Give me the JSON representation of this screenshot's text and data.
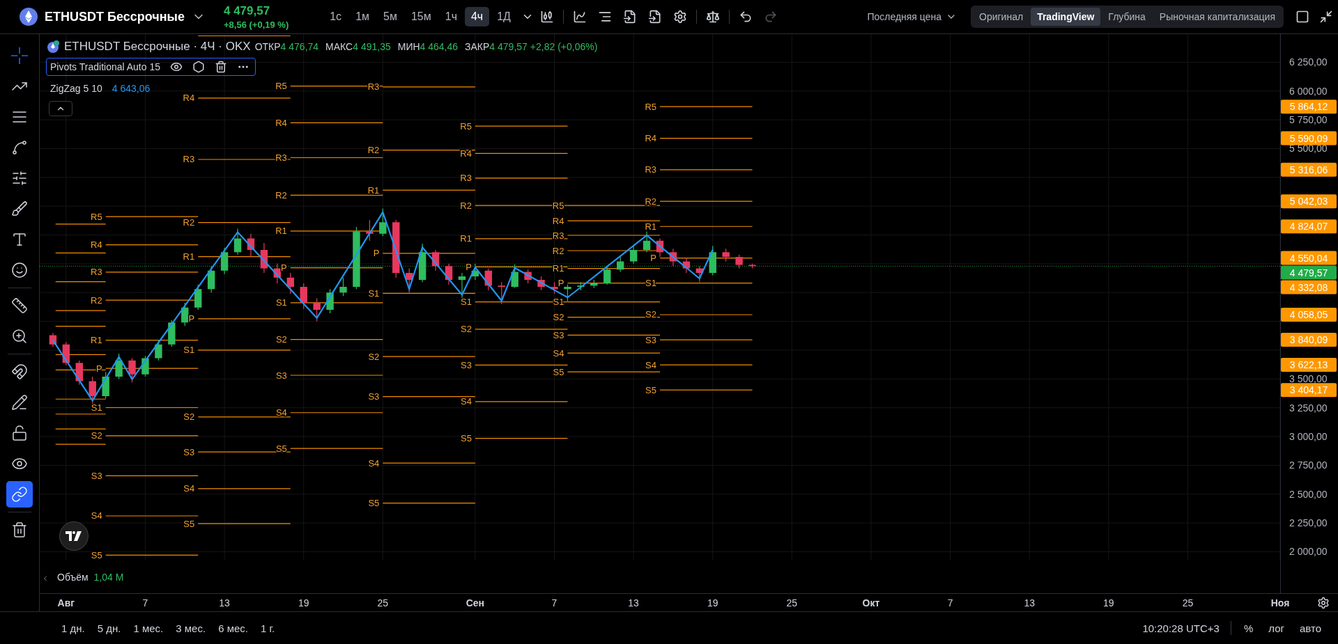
{
  "header": {
    "symbol": "ETHUSDT Бессрочные",
    "price": "4 479,57",
    "change": "+8,56 (+0,19 %)",
    "intervals": [
      {
        "label": "1с",
        "selected": false
      },
      {
        "label": "1м",
        "selected": false
      },
      {
        "label": "5м",
        "selected": false
      },
      {
        "label": "15м",
        "selected": false
      },
      {
        "label": "1ч",
        "selected": false
      },
      {
        "label": "4ч",
        "selected": true
      },
      {
        "label": "1Д",
        "selected": false
      }
    ],
    "price_source": "Последняя цена",
    "views": [
      {
        "label": "Оригинал",
        "selected": false
      },
      {
        "label": "TradingView",
        "selected": true
      },
      {
        "label": "Глубина",
        "selected": false
      },
      {
        "label": "Рыночная капитализация",
        "selected": false
      }
    ]
  },
  "left_toolbar": [
    {
      "kind": "crosshair",
      "selected": true
    },
    {
      "kind": "trend",
      "selected": false
    },
    {
      "kind": "fib",
      "selected": false
    },
    {
      "kind": "pattern",
      "selected": false
    },
    {
      "kind": "forecast",
      "selected": false
    },
    {
      "kind": "brush",
      "selected": false
    },
    {
      "kind": "text",
      "selected": false
    },
    {
      "kind": "emoji",
      "selected": false
    },
    {
      "kind": "measure",
      "selected": false
    },
    {
      "kind": "zoom",
      "selected": false
    },
    {
      "kind": "magnet",
      "selected": false
    },
    {
      "kind": "draw-lock",
      "selected": false
    },
    {
      "kind": "lock",
      "selected": false
    },
    {
      "kind": "eye",
      "selected": false
    },
    {
      "kind": "link",
      "selected": true
    },
    {
      "kind": "trash",
      "selected": false
    }
  ],
  "legend": {
    "title": "ETHUSDT Бессрочные · 4Ч · OKX",
    "ohlc": [
      {
        "label": "ОТКР",
        "value": "4 476,74"
      },
      {
        "label": "МАКС",
        "value": "4 491,35"
      },
      {
        "label": "МИН",
        "value": "4 464,46"
      },
      {
        "label": "ЗАКР",
        "value": "4 479,57"
      }
    ],
    "change": "+2,82 (+0,06%)",
    "indicators": [
      {
        "name": "Pivots Traditional Auto 15",
        "selected": true
      },
      {
        "name": "ZigZag 5 10",
        "value": "4 643,06",
        "selected": false
      }
    ]
  },
  "chart": {
    "chart_data": {
      "type": "candlestick",
      "x": [
        "--07-31",
        "--08-01",
        "--08-02",
        "--08-03",
        "--08-04",
        "--08-05",
        "--08-06",
        "--08-07",
        "--08-08",
        "--08-09",
        "--08-10",
        "--08-11",
        "--08-12",
        "--08-13",
        "--08-14",
        "--08-15",
        "--08-16",
        "--08-17",
        "--08-18",
        "--08-19",
        "--08-20",
        "--08-21",
        "--08-22",
        "--08-23",
        "--08-24",
        "--08-25",
        "--08-26",
        "--08-27",
        "--08-28",
        "--08-29",
        "--08-30",
        "--08-31",
        "--09-01",
        "--09-02",
        "--09-03",
        "--09-04",
        "--09-05",
        "--09-06",
        "--09-07",
        "--09-08",
        "--09-09",
        "--09-10",
        "--09-11",
        "--09-12",
        "--09-13",
        "--09-14",
        "--09-15",
        "--09-16",
        "--09-17",
        "--09-18",
        "--09-19",
        "--09-20",
        "--09-21",
        "--09-22"
      ],
      "ohlc": [
        [
          3880,
          3900,
          3780,
          3800
        ],
        [
          3800,
          3820,
          3620,
          3640
        ],
        [
          3640,
          3660,
          3450,
          3480
        ],
        [
          3480,
          3520,
          3280,
          3350
        ],
        [
          3350,
          3560,
          3330,
          3520
        ],
        [
          3520,
          3720,
          3500,
          3660
        ],
        [
          3660,
          3680,
          3470,
          3540
        ],
        [
          3540,
          3700,
          3520,
          3680
        ],
        [
          3680,
          3840,
          3660,
          3800
        ],
        [
          3800,
          4010,
          3780,
          3990
        ],
        [
          3990,
          4160,
          3960,
          4120
        ],
        [
          4120,
          4320,
          4100,
          4280
        ],
        [
          4280,
          4480,
          4250,
          4440
        ],
        [
          4440,
          4640,
          4410,
          4600
        ],
        [
          4600,
          4805,
          4580,
          4720
        ],
        [
          4720,
          4760,
          4560,
          4620
        ],
        [
          4620,
          4680,
          4420,
          4460
        ],
        [
          4460,
          4500,
          4330,
          4380
        ],
        [
          4380,
          4420,
          4240,
          4300
        ],
        [
          4300,
          4330,
          4110,
          4160
        ],
        [
          4160,
          4200,
          4000,
          4100
        ],
        [
          4100,
          4280,
          4070,
          4250
        ],
        [
          4250,
          4380,
          4220,
          4300
        ],
        [
          4300,
          4820,
          4280,
          4780
        ],
        [
          4780,
          4880,
          4700,
          4760
        ],
        [
          4760,
          4980,
          4740,
          4860
        ],
        [
          4860,
          4880,
          4380,
          4420
        ],
        [
          4420,
          4460,
          4250,
          4360
        ],
        [
          4360,
          4675,
          4340,
          4600
        ],
        [
          4600,
          4620,
          4440,
          4480
        ],
        [
          4480,
          4500,
          4320,
          4360
        ],
        [
          4360,
          4420,
          4200,
          4390
        ],
        [
          4390,
          4500,
          4360,
          4440
        ],
        [
          4440,
          4460,
          4270,
          4310
        ],
        [
          4310,
          4340,
          4150,
          4300
        ],
        [
          4300,
          4495,
          4290,
          4430
        ],
        [
          4430,
          4450,
          4330,
          4360
        ],
        [
          4360,
          4390,
          4270,
          4300
        ],
        [
          4300,
          4340,
          4240,
          4280
        ],
        [
          4280,
          4320,
          4175,
          4300
        ],
        [
          4300,
          4340,
          4270,
          4310
        ],
        [
          4310,
          4360,
          4290,
          4330
        ],
        [
          4330,
          4480,
          4320,
          4450
        ],
        [
          4450,
          4560,
          4430,
          4520
        ],
        [
          4520,
          4660,
          4500,
          4620
        ],
        [
          4620,
          4780,
          4600,
          4700
        ],
        [
          4700,
          4720,
          4560,
          4600
        ],
        [
          4600,
          4630,
          4480,
          4520
        ],
        [
          4520,
          4550,
          4420,
          4460
        ],
        [
          4460,
          4480,
          4340,
          4420
        ],
        [
          4420,
          4655,
          4400,
          4600
        ],
        [
          4600,
          4630,
          4520,
          4560
        ],
        [
          4560,
          4580,
          4460,
          4490
        ],
        [
          4490,
          4500,
          4460,
          4479.57
        ]
      ],
      "series": [
        {
          "type": "line",
          "color": "#2196f3",
          "values": [
            3836,
            3661,
            3487,
            3312,
            3502,
            3691,
            3497,
            3657,
            3816,
            3976,
            4136,
            4296,
            4456,
            4615,
            4775,
            4651,
            4526,
            4402,
            4278,
            4153,
            4029,
            4213,
            4397,
            4580,
            4764,
            4948,
            4614,
            4280,
            4643,
            4506,
            4368,
            4231,
            4469,
            4324,
            4179,
            4465,
            4401,
            4336,
            4272,
            4207,
            4297,
            4387,
            4477,
            4567,
            4657,
            4747,
            4653,
            4559,
            4466,
            4372,
            4622,
            null,
            null,
            null
          ]
        }
      ],
      "xlim": [
        "--07-30",
        "--11-01"
      ],
      "ylim": [
        1640,
        6494
      ],
      "grid": true,
      "xticks": [
        {
          "value": "--08-01",
          "label": "Авг"
        },
        {
          "value": "--08-07",
          "label": "7"
        },
        {
          "value": "--08-13",
          "label": "13"
        },
        {
          "value": "--08-19",
          "label": "19"
        },
        {
          "value": "--08-25",
          "label": "25"
        },
        {
          "value": "--09-01",
          "label": "Сен"
        },
        {
          "value": "--09-07",
          "label": "7"
        },
        {
          "value": "--09-13",
          "label": "13"
        },
        {
          "value": "--09-19",
          "label": "19"
        },
        {
          "value": "--09-25",
          "label": "25"
        },
        {
          "value": "--10-01",
          "label": "Окт"
        },
        {
          "value": "--10-07",
          "label": "7"
        },
        {
          "value": "--10-13",
          "label": "13"
        },
        {
          "value": "--10-19",
          "label": "19"
        },
        {
          "value": "--10-25",
          "label": "25"
        },
        {
          "value": "--11-01",
          "label": "Ноя"
        }
      ],
      "yticks": [
        {
          "value": 6250,
          "label": "6 250,00"
        },
        {
          "value": 6000,
          "label": "6 000,00"
        },
        {
          "value": 5750,
          "label": "5 750,00"
        },
        {
          "value": 5500,
          "label": "5 500,00"
        },
        {
          "value": 3500,
          "label": "3 500,00"
        },
        {
          "value": 3250,
          "label": "3 250,00"
        },
        {
          "value": 3000,
          "label": "3 000,00"
        },
        {
          "value": 2750,
          "label": "2 750,00"
        },
        {
          "value": 2500,
          "label": "2 500,00"
        },
        {
          "value": 2250,
          "label": "2 250,00"
        },
        {
          "value": 2000,
          "label": "2 000,00"
        }
      ],
      "ref_lines": [
        {
          "axis": "y",
          "value": 4479.57,
          "label": "4 479,57",
          "color": "#22ab4a"
        }
      ],
      "annotations": [
        "R5",
        "R4",
        "R3",
        "R2",
        "R1",
        "P",
        "S1",
        "S2",
        "S3",
        "S4",
        "S5",
        "R4",
        "R3",
        "R2",
        "R1",
        "P",
        "S1",
        "S2",
        "S3",
        "S4",
        "S5",
        "R5",
        "R4",
        "R3",
        "R2",
        "R1",
        "P",
        "S1",
        "S2",
        "S3",
        "S4",
        "S5",
        "R3",
        "R2",
        "R1",
        "P",
        "S1",
        "S2",
        "S3",
        "S4",
        "S5",
        "R5",
        "R4",
        "R3",
        "R2",
        "R1",
        "P",
        "S1",
        "S2",
        "S3",
        "S4",
        "S5",
        "R5",
        "R4",
        "R3",
        "R2",
        "R1",
        "P",
        "S1",
        "S2",
        "S3",
        "S4",
        "S5",
        "R5",
        "R4",
        "R3",
        "R2",
        "R1",
        "P",
        "S1",
        "S2",
        "S3",
        "S4",
        "S5",
        "5 864,12",
        "5 590,09",
        "5 316,06",
        "5 042,03",
        "4 824,07",
        "4 550,04",
        "4 332,08",
        "4 058,05",
        "3 840,09",
        "3 622,13",
        "3 404,17"
      ]
    }
  },
  "volume": {
    "label": "Объём",
    "value": "1,04 M"
  },
  "bottom_bar": {
    "ranges": [
      "1 дн.",
      "5 дн.",
      "1 мес.",
      "3 мес.",
      "6 мес.",
      "1 г."
    ],
    "clock": "10:20:28 UTC+3",
    "scale_options": [
      "%",
      "лог",
      "авто"
    ]
  }
}
